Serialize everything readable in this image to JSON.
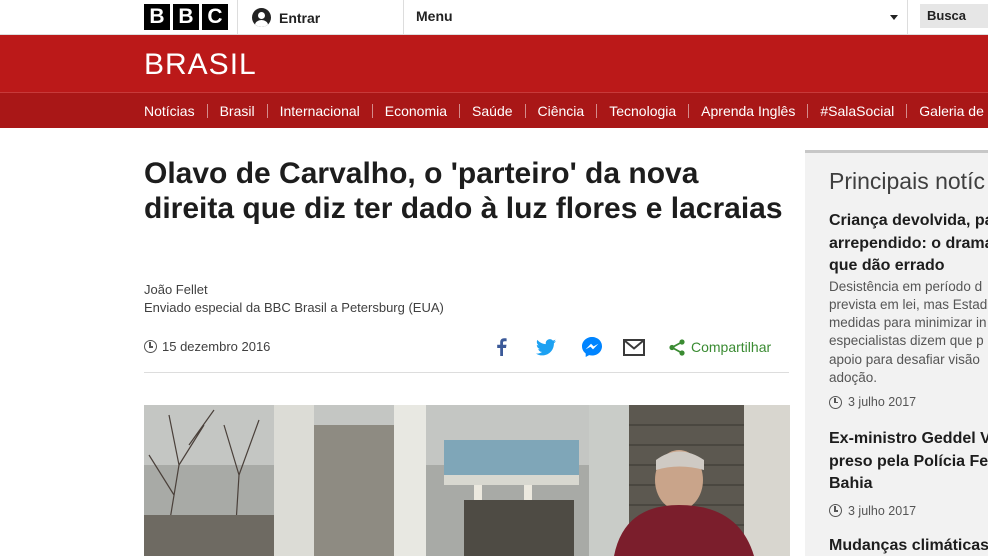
{
  "topbar": {
    "logo_letters": [
      "B",
      "B",
      "C"
    ],
    "signin_label": "Entrar",
    "menu_label": "Menu",
    "search_label": "Busca"
  },
  "brand": {
    "name": "BRASIL",
    "color": "#bb1919"
  },
  "nav": {
    "items": [
      "Notícias",
      "Brasil",
      "Internacional",
      "Economia",
      "Saúde",
      "Ciência",
      "Tecnologia",
      "Aprenda Inglês",
      "#SalaSocial",
      "Galeria de"
    ]
  },
  "article": {
    "headline": "Olavo de Carvalho, o 'parteiro' da nova direita que diz ter dado à luz flores e lacraias",
    "author": "João Fellet",
    "author_role": "Enviado especial da BBC Brasil a Petersburg (EUA)",
    "date": "15 dezembro 2016",
    "share_label": "Compartilhar",
    "share_icons": [
      "facebook-icon",
      "twitter-icon",
      "messenger-icon",
      "email-icon",
      "share-icon"
    ]
  },
  "sidebar": {
    "title": "Principais notíc",
    "items": [
      {
        "headline_lines": [
          "Criança devolvida, pa",
          "arrependido: o drama",
          "que dão errado"
        ],
        "summary_lines": [
          "Desistência em período d",
          "prevista em lei, mas Estad",
          "medidas para minimizar in",
          "especialistas dizem que p",
          "apoio para desafiar visão",
          "adoção."
        ],
        "date": "3 julho 2017"
      },
      {
        "headline_lines": [
          "Ex-ministro Geddel V",
          "preso pela Polícia Fe",
          "Bahia"
        ],
        "date": "3 julho 2017"
      },
      {
        "headline_lines": [
          "Mudanças climáticas"
        ]
      }
    ]
  }
}
